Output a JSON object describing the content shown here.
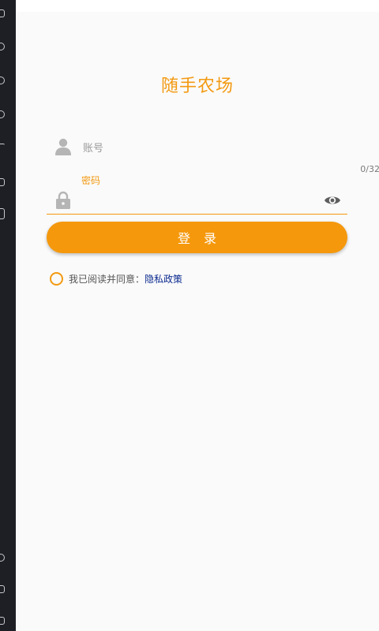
{
  "app": {
    "title": "随手农场"
  },
  "login_form": {
    "account_placeholder": "账号",
    "password_label": "密码",
    "password_counter": "0/32",
    "login_button": "登 录"
  },
  "agreement": {
    "text": "我已阅读并同意：",
    "link": "隐私政策"
  },
  "colors": {
    "accent": "#f39a12",
    "link": "#0b2a8f",
    "background": "#fafafa"
  },
  "icons": [
    "user-icon",
    "lock-icon",
    "eye-icon",
    "radio-unchecked-icon"
  ]
}
